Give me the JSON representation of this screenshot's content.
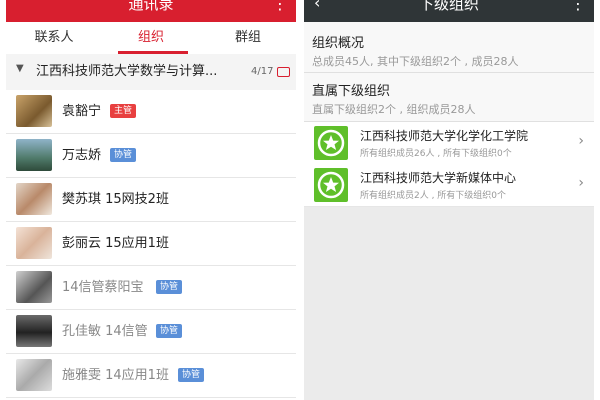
{
  "left": {
    "title": "通讯录",
    "more_icon": "more-vertical-icon",
    "tabs": [
      {
        "label": "联系人",
        "active": false
      },
      {
        "label": "组织",
        "active": true
      },
      {
        "label": "群组",
        "active": false
      }
    ],
    "group": {
      "name": "江西科技师范大学数学与计算...",
      "count": "4/17",
      "expand_icon": "triangle-down-icon",
      "chat_icon": "chat-icon"
    },
    "members": [
      {
        "name": "袁豁宁",
        "badge": "主管",
        "badge_color": "#e84040",
        "dim": false
      },
      {
        "name": "万志娇",
        "badge": "协管",
        "badge_color": "#5a8fd8",
        "dim": false
      },
      {
        "name": "樊苏琪 15网技2班",
        "badge": "",
        "dim": false
      },
      {
        "name": "彭丽云 15应用1班",
        "badge": "",
        "dim": false
      },
      {
        "name": "14信管蔡阳宝",
        "badge": "协管",
        "badge_color": "#5a8fd8",
        "dim": true
      },
      {
        "name": "孔佳敏 14信管",
        "badge": "协管",
        "badge_color": "#5a8fd8",
        "dim": true
      },
      {
        "name": "施雅雯 14应用1班",
        "badge": "协管",
        "badge_color": "#5a8fd8",
        "dim": true
      }
    ]
  },
  "right": {
    "title": "下级组织",
    "back_icon": "back-arrow-icon",
    "more_icon": "more-vertical-icon",
    "overview": {
      "title": "组织概况",
      "summary": "总成员45人, 其中下级组织2个 , 成员28人"
    },
    "direct": {
      "title": "直属下级组织",
      "summary": "直属下级组织2个 , 组织成员28人"
    },
    "orgs": [
      {
        "name": "江西科技师范大学化学化工学院",
        "info": "所有组织成员26人 , 所有下级组织0个",
        "logo_icon": "star-badge-icon",
        "chevron_icon": "chevron-right-icon"
      },
      {
        "name": "江西科技师范大学新媒体中心",
        "info": "所有组织成员2人 , 所有下级组织0个",
        "logo_icon": "star-badge-icon",
        "chevron_icon": "chevron-right-icon"
      }
    ]
  },
  "colors": {
    "accent_red": "#d81f2f",
    "logo_green": "#5fbf2a",
    "dark_bar": "#2f3537"
  }
}
